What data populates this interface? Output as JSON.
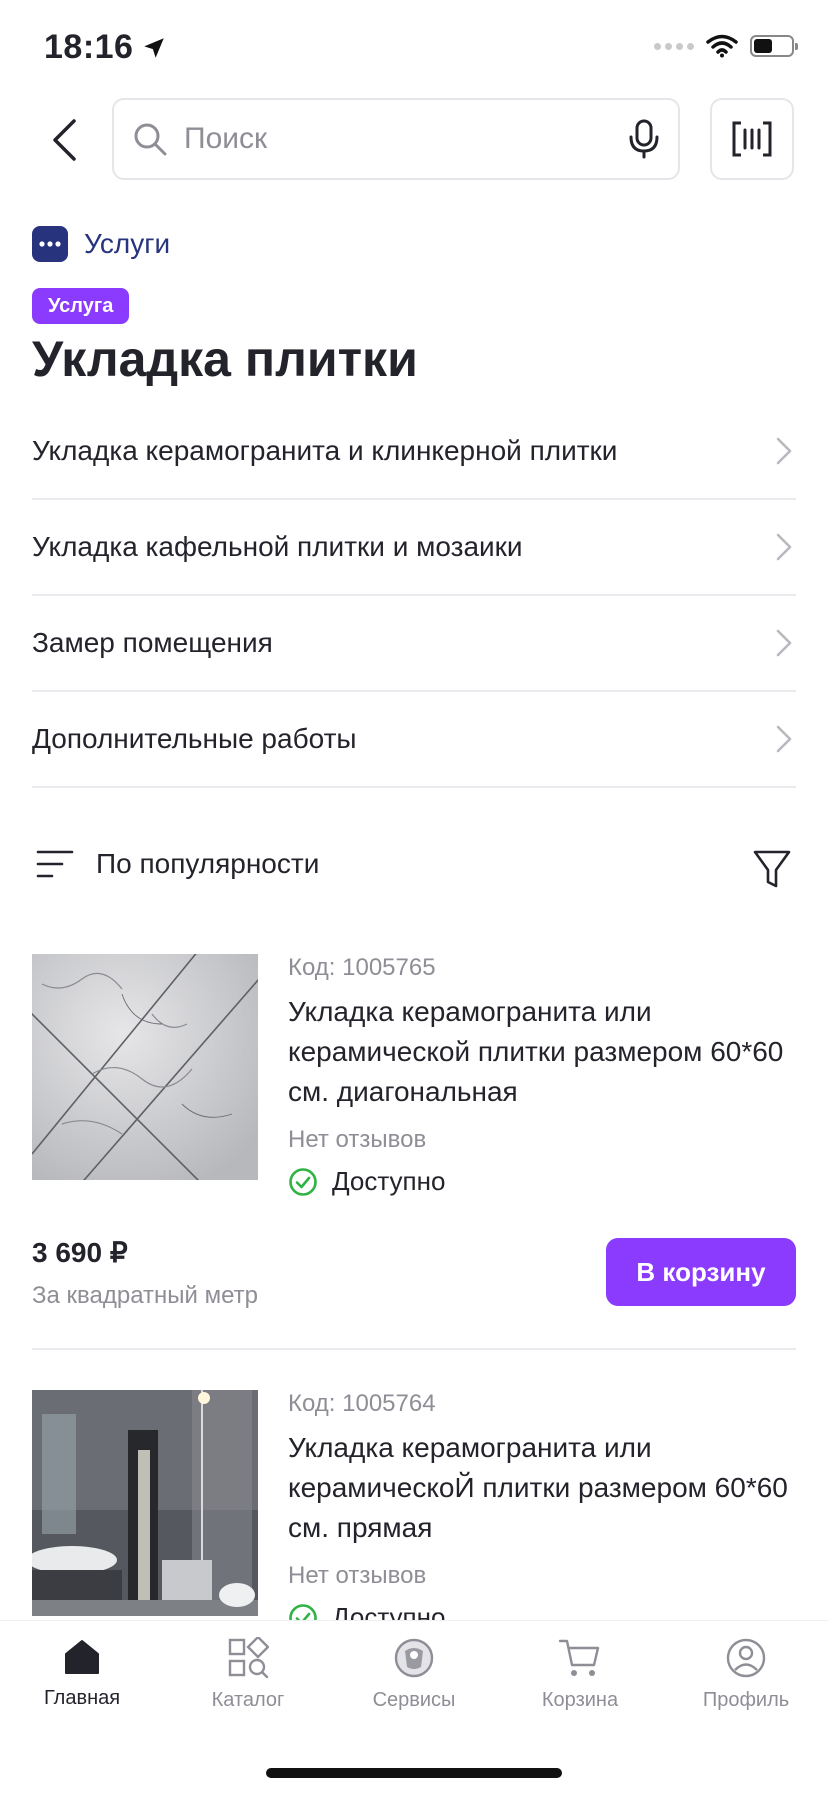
{
  "status_bar": {
    "time": "18:16"
  },
  "search": {
    "placeholder": "Поиск"
  },
  "category": {
    "icon": "more-dots-icon",
    "label": "Услуги",
    "color": "#27337d"
  },
  "badge": {
    "label": "Услуга",
    "color": "#8b3bfd"
  },
  "page_title": "Укладка плитки",
  "subcategories": [
    {
      "label": "Укладка керамогранита и клинкерной плитки"
    },
    {
      "label": "Укладка кафельной плитки и мозаики"
    },
    {
      "label": "Замер помещения"
    },
    {
      "label": "Дополнительные работы"
    }
  ],
  "sort": {
    "label": "По популярности"
  },
  "products": [
    {
      "code": "Код: 1005765",
      "name": "Укладка керамогранита или керамической плитки размером 60*60 см. диагональная",
      "reviews": "Нет отзывов",
      "availability": "Доступно",
      "price": "3 690 ₽",
      "unit": "За квадратный метр",
      "cart_button": "В корзину"
    },
    {
      "code": "Код: 1005764",
      "name": "Укладка керамогранита или керамическоЙ плитки размером 60*60 см. прямая",
      "reviews": "Нет отзывов",
      "availability": "Доступно"
    }
  ],
  "tabs": [
    {
      "label": "Главная",
      "icon": "home-icon",
      "active": true
    },
    {
      "label": "Каталог",
      "icon": "catalog-icon",
      "active": false
    },
    {
      "label": "Сервисы",
      "icon": "services-icon",
      "active": false
    },
    {
      "label": "Корзина",
      "icon": "cart-icon",
      "active": false
    },
    {
      "label": "Профиль",
      "icon": "profile-icon",
      "active": false
    }
  ],
  "colors": {
    "accent": "#8b3bfd",
    "brand": "#27337d",
    "available": "#2fb344"
  }
}
